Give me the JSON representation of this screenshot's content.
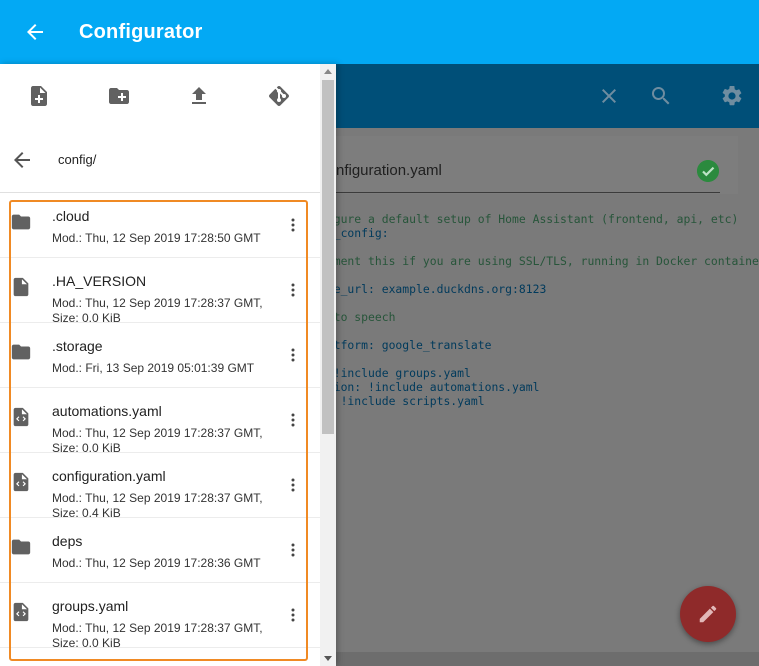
{
  "header": {
    "title": "Configurator"
  },
  "path": "config/",
  "items": [
    {
      "name": ".cloud",
      "type": "folder",
      "meta": "Mod.: Thu, 12 Sep 2019 17:28:50 GMT"
    },
    {
      "name": ".HA_VERSION",
      "type": "file",
      "meta": "Mod.: Thu, 12 Sep 2019 17:28:37 GMT, Size: 0.0 KiB"
    },
    {
      "name": ".storage",
      "type": "folder",
      "meta": "Mod.: Fri, 13 Sep 2019 05:01:39 GMT"
    },
    {
      "name": "automations.yaml",
      "type": "code-file",
      "meta": "Mod.: Thu, 12 Sep 2019 17:28:37 GMT, Size: 0.0 KiB"
    },
    {
      "name": "configuration.yaml",
      "type": "code-file",
      "meta": "Mod.: Thu, 12 Sep 2019 17:28:37 GMT, Size: 0.4 KiB"
    },
    {
      "name": "deps",
      "type": "folder",
      "meta": "Mod.: Thu, 12 Sep 2019 17:28:36 GMT"
    },
    {
      "name": "groups.yaml",
      "type": "code-file",
      "meta": "Mod.: Thu, 12 Sep 2019 17:28:37 GMT, Size: 0.0 KiB"
    }
  ],
  "editor": {
    "filename": "nfiguration.yaml",
    "code_lines": [
      {
        "k": "c-com",
        "t": "figure a default setup of Home Assistant (frontend, api, etc)"
      },
      {
        "k": "c-key",
        "t": "lt_config:"
      },
      {
        "k": "c-dim",
        "t": ""
      },
      {
        "k": "c-com",
        "t": "omment this if you are using SSL/TLS, running in Docker containe"
      },
      {
        "k": "c-key",
        "t": "p:"
      },
      {
        "k": "c-key",
        "t": "ase_url: example.duckdns.org:8123"
      },
      {
        "k": "c-dim",
        "t": ""
      },
      {
        "k": "c-com",
        "t": "t to speech"
      },
      {
        "k": "c-dim",
        "t": ""
      },
      {
        "k": "c-key",
        "t": "latform: google_translate"
      },
      {
        "k": "c-dim",
        "t": ""
      },
      {
        "k": "c-key",
        "t": ": !include groups.yaml"
      },
      {
        "k": "c-key",
        "t": "ation: !include automations.yaml"
      },
      {
        "k": "c-key",
        "t": "t: !include scripts.yaml"
      }
    ]
  },
  "colors": {
    "header": "#03a9f4",
    "editor_toolbar": "#004f78",
    "highlight": "#f08a24",
    "fab": "#8f2a2a"
  }
}
